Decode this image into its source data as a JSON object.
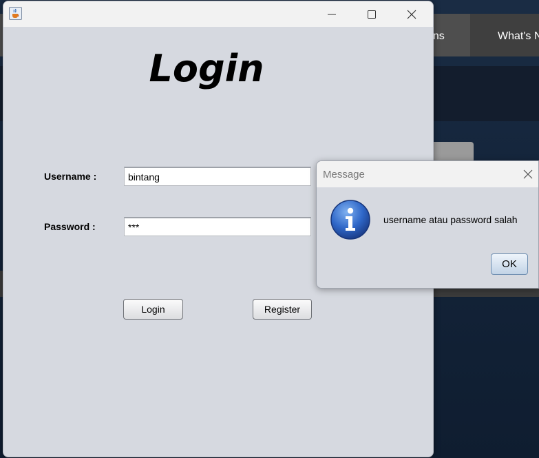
{
  "background": {
    "nav_items": [
      "ans",
      "What's N"
    ]
  },
  "window": {
    "icon": "java-coffee-icon",
    "controls": [
      "minimize-icon",
      "maximize-icon",
      "close-icon"
    ]
  },
  "login_form": {
    "title": "Login",
    "username_label": "Username  :",
    "username_value": "bintang",
    "password_label": "Password :",
    "password_value": "***",
    "login_button": "Login",
    "register_button": "Register"
  },
  "message_dialog": {
    "title": "Message",
    "icon": "information-icon",
    "message": "username atau password salah",
    "ok_button": "OK"
  }
}
